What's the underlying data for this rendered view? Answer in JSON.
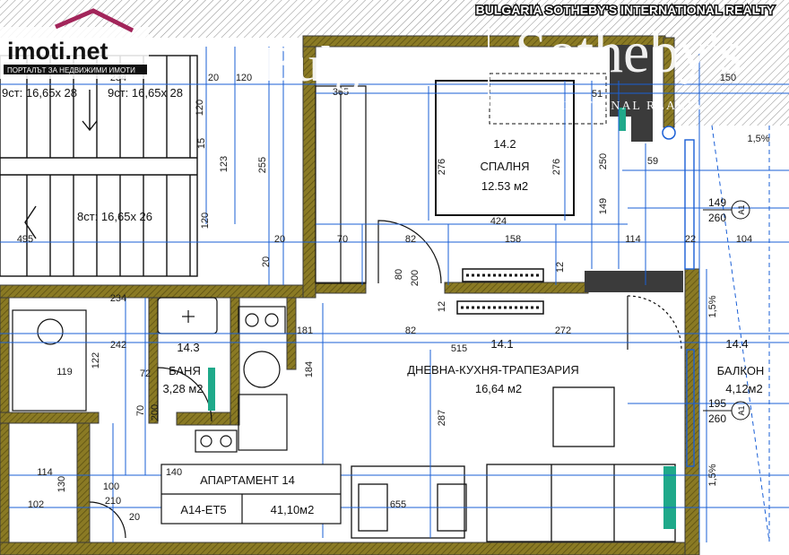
{
  "header": {
    "agency": "BULGARIA SOTHEBY'S INTERNATIONAL REALTY"
  },
  "logo": {
    "name": "imoti.net",
    "tagline": "ПОРТАЛЪТ ЗА НЕДВИЖИМИ ИМОТИ"
  },
  "watermark": {
    "left": "Bulgaria",
    "right": "Sotheby's",
    "sub": "INTERNATIONAL REALTY"
  },
  "rooms": [
    {
      "number": "14.2",
      "name": "СПАЛНЯ",
      "area": "12.53 м2"
    },
    {
      "number": "14.3",
      "name": "БАНЯ",
      "area": "3,28 м2"
    },
    {
      "number": "14.1",
      "name": "ДНЕВНА-КУХНЯ-ТРАПЕЗАРИЯ",
      "area": "16,64 м2"
    },
    {
      "number": "14.4",
      "name": "БАЛКОН",
      "area": "4,12м2"
    }
  ],
  "stairs": [
    "9ст: 16,65х 28",
    "9ст: 16,65х 28",
    "8ст: 16,65х 26"
  ],
  "apartment": {
    "title": "АПАРТАМЕНТ 14",
    "code": "А14-ЕТ5",
    "area": "41,10м2"
  },
  "windows": [
    {
      "tag": "А1",
      "w": "149",
      "h": "260"
    },
    {
      "tag": "А1",
      "w": "195",
      "h": "260"
    }
  ],
  "dimensions": [
    "234",
    "120",
    "20",
    "365",
    "51",
    "150",
    "120",
    "15",
    "123",
    "255",
    "276",
    "276",
    "250",
    "1,5%",
    "59",
    "149",
    "120",
    "424",
    "495",
    "20",
    "70",
    "82",
    "158",
    "114",
    "22",
    "104",
    "20",
    "80",
    "200",
    "12",
    "12",
    "234",
    "242",
    "181",
    "82",
    "272",
    "1,5%",
    "515",
    "122",
    "119",
    "72",
    "184",
    "70",
    "200",
    "287",
    "140",
    "114",
    "100",
    "210",
    "130",
    "102",
    "20",
    "655",
    "1,5%"
  ],
  "colors": {
    "wall": "#3b3b3b",
    "wall_hatch": "#7a6a1e",
    "dim_line": "#1a5fd6",
    "fixture": "#1fa98a",
    "drawing": "#111111"
  }
}
